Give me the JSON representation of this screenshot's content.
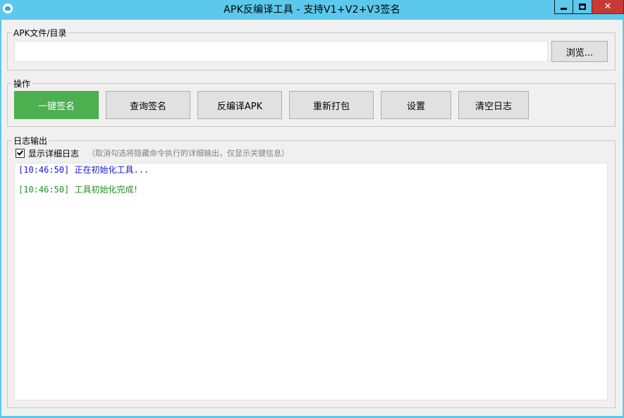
{
  "window": {
    "title": "APK反编译工具 - 支持V1+V2+V3签名",
    "close_glyph": "✕",
    "accent_color": "#5cc8ec"
  },
  "file_group": {
    "legend": "APK文件/目录",
    "path_value": "",
    "browse_label": "浏览..."
  },
  "ops_group": {
    "legend": "操作",
    "buttons": [
      {
        "label": "一键签名",
        "color": "#4caf50"
      },
      {
        "label": "查询签名"
      },
      {
        "label": "反编译APK"
      },
      {
        "label": "重新打包"
      },
      {
        "label": "设置"
      },
      {
        "label": "清空日志"
      }
    ]
  },
  "log_group": {
    "legend": "日志输出",
    "verbose_checked": true,
    "verbose_label": "显示详细日志",
    "verbose_hint": "（取消勾选将隐藏命令执行的详细输出，仅显示关键信息）",
    "lines": [
      {
        "text": "[10:46:50] 正在初始化工具...",
        "level": "info",
        "color": "#1515e0"
      },
      {
        "text": "[10:46:50] 工具初始化完成！",
        "level": "success",
        "color": "#1f8f1f"
      }
    ]
  }
}
